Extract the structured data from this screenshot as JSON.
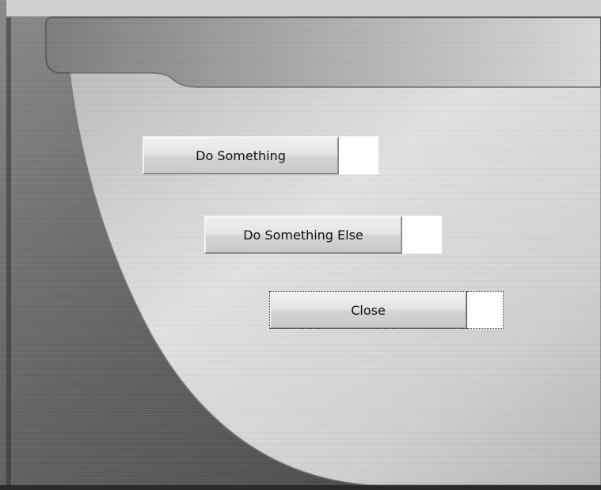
{
  "window": {
    "skin_colors": {
      "outer_dark": "#4a4a4a",
      "outer_mid": "#707070",
      "header_light": "#c8c8c8",
      "panel_light": "#d8d8d8",
      "panel_dark": "#9a9a9a"
    }
  },
  "buttons": {
    "do_something": {
      "label": "Do Something"
    },
    "do_something_else": {
      "label": "Do Something Else"
    },
    "close": {
      "label": "Close"
    }
  }
}
